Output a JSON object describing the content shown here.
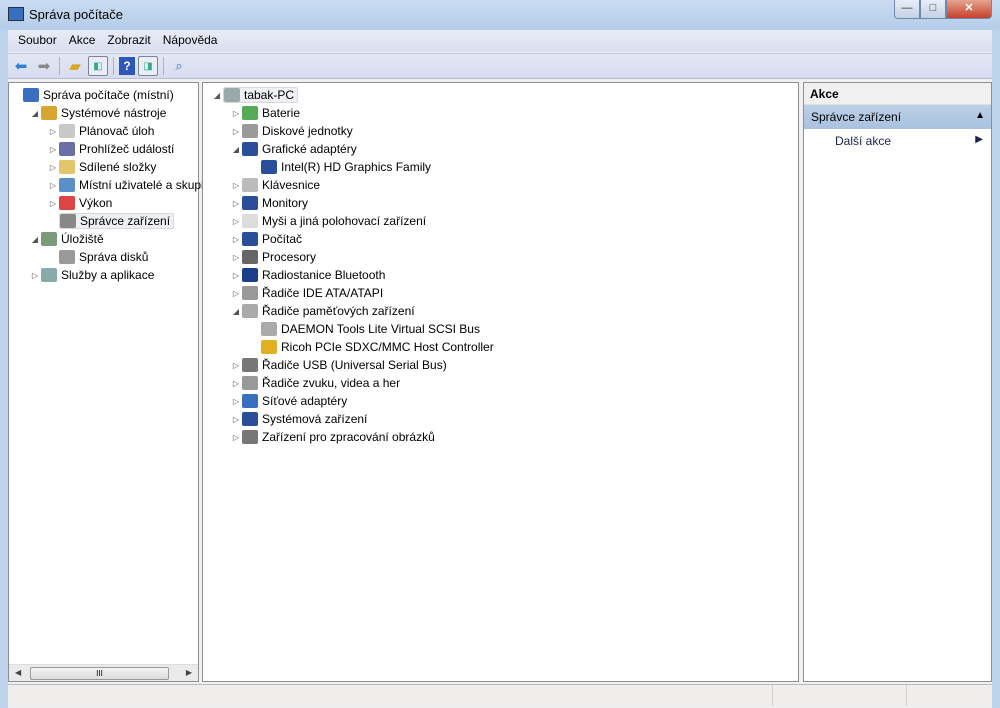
{
  "window": {
    "title": "Správa počítače",
    "minimize": "—",
    "maximize": "□",
    "close": "✕"
  },
  "menu": [
    "Soubor",
    "Akce",
    "Zobrazit",
    "Nápověda"
  ],
  "left_tree": [
    {
      "label": "Správa počítače (místní)",
      "level": 0,
      "exp": "",
      "icon": "computer-management-icon",
      "color": "#3a6fc0"
    },
    {
      "label": "Systémové nástroje",
      "level": 1,
      "exp": "◢",
      "icon": "tools-icon",
      "color": "#d6a630"
    },
    {
      "label": "Plánovač úloh",
      "level": 2,
      "exp": "▷",
      "icon": "clock-icon",
      "color": "#c8c8c8"
    },
    {
      "label": "Prohlížeč událostí",
      "level": 2,
      "exp": "▷",
      "icon": "event-viewer-icon",
      "color": "#6a6fa8"
    },
    {
      "label": "Sdílené složky",
      "level": 2,
      "exp": "▷",
      "icon": "shared-folder-icon",
      "color": "#e5c56b"
    },
    {
      "label": "Místní uživatelé a skupiny",
      "level": 2,
      "exp": "▷",
      "icon": "users-icon",
      "color": "#5b8fc8"
    },
    {
      "label": "Výkon",
      "level": 2,
      "exp": "▷",
      "icon": "performance-icon",
      "color": "#d44"
    },
    {
      "label": "Správce zařízení",
      "level": 2,
      "exp": "",
      "icon": "device-manager-icon",
      "color": "#888",
      "selected": true
    },
    {
      "label": "Úložiště",
      "level": 1,
      "exp": "◢",
      "icon": "storage-icon",
      "color": "#7a9a7a"
    },
    {
      "label": "Správa disků",
      "level": 2,
      "exp": "",
      "icon": "disk-management-icon",
      "color": "#999"
    },
    {
      "label": "Služby a aplikace",
      "level": 1,
      "exp": "▷",
      "icon": "services-icon",
      "color": "#8aa"
    }
  ],
  "device_tree": [
    {
      "label": "tabak-PC",
      "level": 0,
      "exp": "◢",
      "icon": "computer-icon",
      "color": "#9aa",
      "selected": true
    },
    {
      "label": "Baterie",
      "level": 1,
      "exp": "▷",
      "icon": "battery-icon",
      "color": "#5a5"
    },
    {
      "label": "Diskové jednotky",
      "level": 1,
      "exp": "▷",
      "icon": "disk-drive-icon",
      "color": "#999"
    },
    {
      "label": "Grafické adaptéry",
      "level": 1,
      "exp": "◢",
      "icon": "display-adapter-icon",
      "color": "#2a4f9a"
    },
    {
      "label": "Intel(R) HD Graphics Family",
      "level": 2,
      "exp": "",
      "icon": "display-adapter-icon",
      "color": "#2a4f9a"
    },
    {
      "label": "Klávesnice",
      "level": 1,
      "exp": "▷",
      "icon": "keyboard-icon",
      "color": "#bbb"
    },
    {
      "label": "Monitory",
      "level": 1,
      "exp": "▷",
      "icon": "monitor-icon",
      "color": "#2a4f9a"
    },
    {
      "label": "Myši a jiná polohovací zařízení",
      "level": 1,
      "exp": "▷",
      "icon": "mouse-icon",
      "color": "#ddd"
    },
    {
      "label": "Počítač",
      "level": 1,
      "exp": "▷",
      "icon": "computer-icon",
      "color": "#2a4f9a"
    },
    {
      "label": "Procesory",
      "level": 1,
      "exp": "▷",
      "icon": "processor-icon",
      "color": "#666"
    },
    {
      "label": "Radiostanice Bluetooth",
      "level": 1,
      "exp": "▷",
      "icon": "bluetooth-icon",
      "color": "#1a3f8a"
    },
    {
      "label": "Řadiče IDE ATA/ATAPI",
      "level": 1,
      "exp": "▷",
      "icon": "ide-controller-icon",
      "color": "#999"
    },
    {
      "label": "Řadiče paměťových zařízení",
      "level": 1,
      "exp": "◢",
      "icon": "storage-controller-icon",
      "color": "#aaa"
    },
    {
      "label": "DAEMON Tools Lite Virtual SCSI Bus",
      "level": 2,
      "exp": "",
      "icon": "storage-controller-icon",
      "color": "#aaa"
    },
    {
      "label": "Ricoh PCIe SDXC/MMC Host Controller",
      "level": 2,
      "exp": "",
      "icon": "warning-device-icon",
      "color": "#e0b020"
    },
    {
      "label": "Řadiče USB (Universal Serial Bus)",
      "level": 1,
      "exp": "▷",
      "icon": "usb-icon",
      "color": "#777"
    },
    {
      "label": "Řadiče zvuku, videa a her",
      "level": 1,
      "exp": "▷",
      "icon": "speaker-icon",
      "color": "#999"
    },
    {
      "label": "Síťové adaptéry",
      "level": 1,
      "exp": "▷",
      "icon": "network-adapter-icon",
      "color": "#3a6fc0"
    },
    {
      "label": "Systémová zařízení",
      "level": 1,
      "exp": "▷",
      "icon": "system-devices-icon",
      "color": "#2a4f9a"
    },
    {
      "label": "Zařízení pro zpracování obrázků",
      "level": 1,
      "exp": "▷",
      "icon": "camera-icon",
      "color": "#777"
    }
  ],
  "actions": {
    "header": "Akce",
    "section": "Správce zařízení",
    "item": "Další akce"
  },
  "scrollbar": {
    "grip": "III"
  }
}
